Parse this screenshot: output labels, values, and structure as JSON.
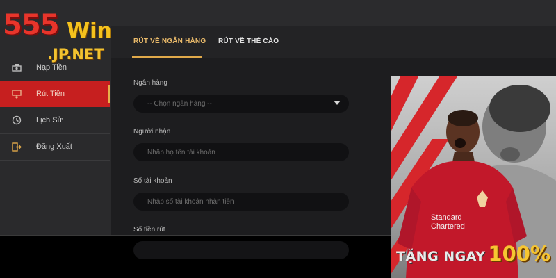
{
  "logo": {
    "brand_number": "555",
    "brand_word": "Win",
    "domain": ".JP.NET"
  },
  "sidebar": {
    "items": [
      {
        "label": "Nạp Tiền",
        "icon": "deposit-icon",
        "active": false
      },
      {
        "label": "Rút Tiền",
        "icon": "withdraw-icon",
        "active": true
      },
      {
        "label": "Lịch Sử",
        "icon": "history-icon",
        "active": false
      },
      {
        "label": "Đăng Xuất",
        "icon": "logout-icon",
        "active": false
      }
    ]
  },
  "tabs": [
    {
      "label": "RÚT VỀ NGÂN HÀNG",
      "active": true
    },
    {
      "label": "RÚT VỀ THẺ CÀO",
      "active": false
    }
  ],
  "form": {
    "bank": {
      "label": "Ngân hàng",
      "placeholder": "-- Chọn ngân hàng --"
    },
    "recipient": {
      "label": "Người nhận",
      "placeholder": "Nhập họ tên tài khoản"
    },
    "account": {
      "label": "Số tài khoản",
      "placeholder": "Nhập số tài khoản nhận tiền"
    },
    "amount": {
      "label": "Số tiền rút"
    }
  },
  "promo": {
    "text_a": "TẶNG NGAY",
    "text_b": "100%"
  },
  "colors": {
    "accent_red": "#c61f1f",
    "accent_gold": "#e0a94a",
    "background": "#1d1d1f"
  }
}
